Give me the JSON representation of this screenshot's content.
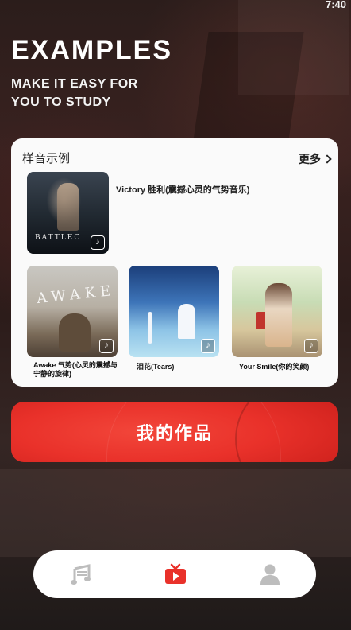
{
  "status_bar": {
    "time": "7:40"
  },
  "hero": {
    "title": "EXAMPLES",
    "subtitle_line1": "MAKE IT EASY FOR",
    "subtitle_line2": "YOU TO STUDY"
  },
  "samples": {
    "title": "样音示例",
    "more": "更多",
    "featured": {
      "cover_text": "BATTLEC",
      "title": "Victory 胜利(震撼心灵的气势音乐)"
    },
    "items": [
      {
        "cover_text": "AWAKE",
        "title": "Awake 气势(心灵的震撼与宁静的旋律)"
      },
      {
        "title": "泪花(Tears)"
      },
      {
        "title": "Your Smile(你的笑颜)"
      }
    ]
  },
  "works_button": {
    "label": "我的作品"
  },
  "tabbar": {
    "items": [
      {
        "icon": "music-notes-icon",
        "active": false
      },
      {
        "icon": "video-icon",
        "active": true
      },
      {
        "icon": "user-icon",
        "active": false
      }
    ]
  },
  "colors": {
    "accent": "#e9312a",
    "tab_inactive": "#bdbdbd"
  }
}
